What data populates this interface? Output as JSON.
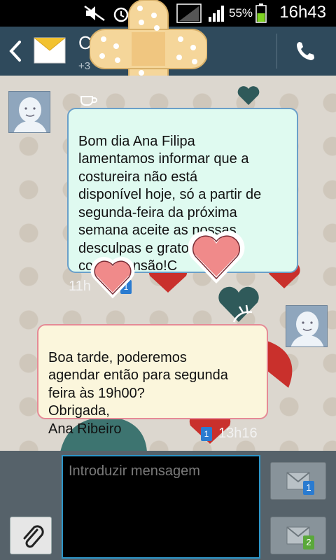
{
  "status_bar": {
    "battery_percent": "55%",
    "time": "16h43"
  },
  "header": {
    "contact_name": "C",
    "contact_number": "+3",
    "call_icon": "phone-icon",
    "back_icon": "chevron-left-icon",
    "app_icon": "envelope-icon"
  },
  "messages": [
    {
      "direction": "incoming",
      "text": "Bom dia Ana Filipa\nlamentamos informar que a\ncostureira não está\ndisponível hoje, só a partir de\nsegunda-feira da próxima\nsemana aceite as nossas\ndesculpas e gratos pela\ncompreensão!C",
      "time": "11h",
      "sim": "1"
    },
    {
      "direction": "outgoing",
      "text": "Boa tarde, poderemos\nagendar então para segunda\nfeira às 19h00?\nObrigada,\nAna Ribeiro",
      "time": "13h16",
      "sim": "1"
    }
  ],
  "composer": {
    "placeholder": "Introduzir mensagem",
    "attach_icon": "paperclip-icon",
    "send_sim1_label": "1",
    "send_sim2_label": "2"
  },
  "colors": {
    "header": "#2f4a5c",
    "incoming_bubble": "#dffaf0",
    "incoming_border": "#6a9fc9",
    "outgoing_bubble": "#fbf6dc",
    "outgoing_border": "#e58a96",
    "input_border": "#2c95c8",
    "sim1": "#2a7bd0",
    "sim2": "#5aa83a"
  }
}
